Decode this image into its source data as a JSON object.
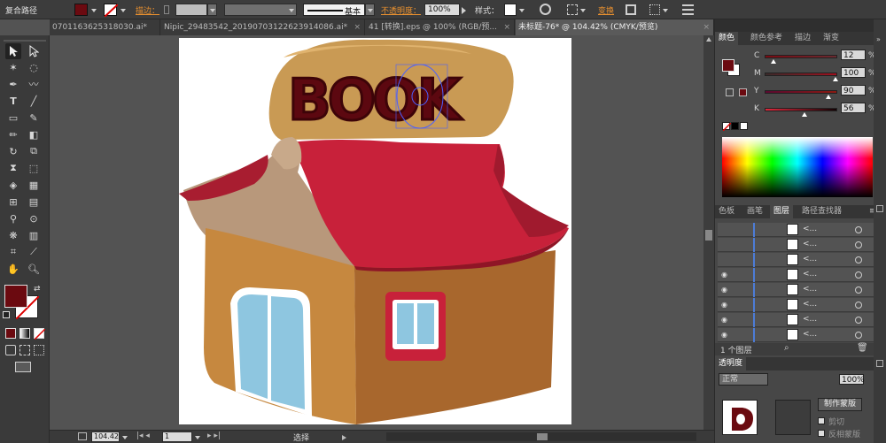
{
  "control_bar": {
    "selection_type": "复合路径",
    "stroke_label": "描边：",
    "stroke_style": "基本",
    "opacity_label": "不透明度：",
    "opacity_value": "100%",
    "style_label": "样式：",
    "transform_label": "变换"
  },
  "tabs": [
    {
      "label": "0701163625318030.ai*",
      "close": "×"
    },
    {
      "label": "Nipic_29483542_20190703122623914086.ai*",
      "close": "×"
    },
    {
      "label": "41 [转换].eps @ 100% (RGB/预...",
      "close": "×"
    },
    {
      "label": "未标题-76* @ 104.42% (CMYK/预览)",
      "close": "×"
    }
  ],
  "artwork": {
    "sign_text": "BOOK"
  },
  "status_bar": {
    "zoom": "104.42",
    "page": "1",
    "tool": "选择"
  },
  "color_panel": {
    "tabs": [
      "颜色",
      "颜色参考",
      "描边",
      "渐变"
    ],
    "channels": [
      {
        "label": "C",
        "value": "12",
        "unit": "%",
        "fraction": 0.12
      },
      {
        "label": "M",
        "value": "100",
        "unit": "%",
        "fraction": 1.0
      },
      {
        "label": "Y",
        "value": "90",
        "unit": "%",
        "fraction": 0.9
      },
      {
        "label": "K",
        "value": "56",
        "unit": "%",
        "fraction": 0.56
      }
    ]
  },
  "layers_panel": {
    "tabs": [
      "色板",
      "画笔",
      "图层",
      "路径查找器"
    ],
    "row_label": "<...",
    "footer": "1 个图层"
  },
  "transparency_panel": {
    "title": "透明度",
    "mode": "正常",
    "opacity": "100%",
    "make_mask_button": "制作蒙版",
    "clip_label": "剪切",
    "invert_label": "反相蒙版"
  },
  "colors": {
    "fill": "#6b0a10",
    "roof": "#c8213a",
    "wall_front": "#c6883f",
    "wall_side": "#a8672d",
    "window": "#8ec6e0"
  }
}
